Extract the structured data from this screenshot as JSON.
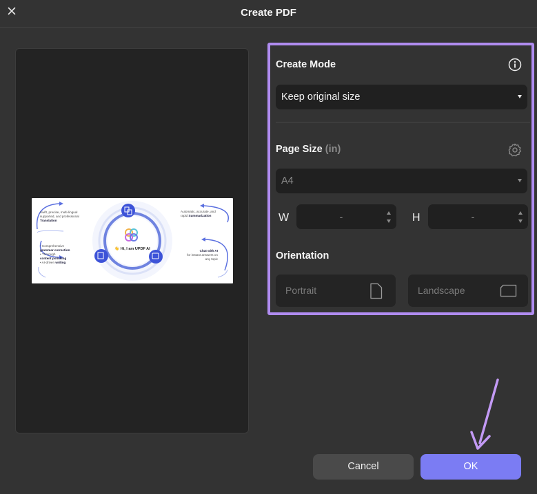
{
  "window": {
    "title": "Create PDF",
    "close_icon": "close-icon"
  },
  "preview": {
    "thumbnail": {
      "left_top": "Swift, precise, multi-lingual supported, and professional",
      "left_top_bold": "Translation",
      "left_bottom_1": "Comprehensive",
      "left_bottom_1_bold": "grammar correction",
      "left_bottom_2": "Thorough",
      "left_bottom_2_bold": "content polishing",
      "left_bottom_3": "AI-driven",
      "left_bottom_3_bold": "writing",
      "right_top": "Automatic, accurate, and rapid",
      "right_top_bold": "Summarization",
      "right_bottom_bold": "Chat with AI",
      "right_bottom": "for instant answers on any topic",
      "center": "👋 Hi, I am UPDF AI"
    }
  },
  "create_mode": {
    "label": "Create Mode",
    "info_icon": "info-icon",
    "value": "Keep original size"
  },
  "page_size": {
    "label": "Page Size",
    "unit": "(in)",
    "settings_icon": "gear-icon",
    "value": "A4",
    "width_label": "W",
    "width_value": "-",
    "height_label": "H",
    "height_value": "-"
  },
  "orientation": {
    "label": "Orientation",
    "portrait": "Portrait",
    "landscape": "Landscape"
  },
  "buttons": {
    "cancel": "Cancel",
    "ok": "OK"
  },
  "colors": {
    "background": "#333333",
    "highlight_border": "#b08cf0",
    "ok_button": "#7b7cf3",
    "annotation_arrow": "#c39af5"
  }
}
